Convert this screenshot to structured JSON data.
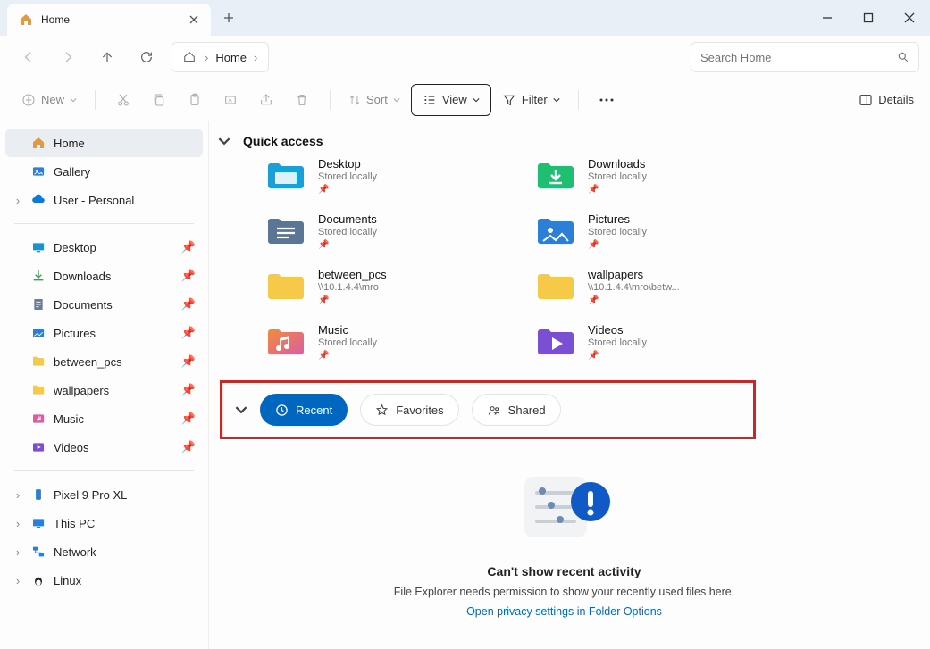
{
  "window": {
    "tab_title": "Home",
    "new_tab": "New tab",
    "minimize": "Minimize",
    "maximize": "Restore",
    "close": "Close"
  },
  "nav": {
    "breadcrumb": {
      "root": "Home"
    },
    "search_placeholder": "Search Home"
  },
  "toolbar": {
    "new": "New",
    "sort": "Sort",
    "view": "View",
    "filter": "Filter",
    "details": "Details"
  },
  "sidebar": {
    "home": "Home",
    "gallery": "Gallery",
    "user_personal": "User - Personal",
    "pinned": [
      {
        "label": "Desktop"
      },
      {
        "label": "Downloads"
      },
      {
        "label": "Documents"
      },
      {
        "label": "Pictures"
      },
      {
        "label": "between_pcs"
      },
      {
        "label": "wallpapers"
      },
      {
        "label": "Music"
      },
      {
        "label": "Videos"
      }
    ],
    "devices": [
      {
        "label": "Pixel 9 Pro XL"
      },
      {
        "label": "This PC"
      },
      {
        "label": "Network"
      },
      {
        "label": "Linux"
      }
    ]
  },
  "quick_access": {
    "header": "Quick access",
    "items": [
      {
        "name": "Desktop",
        "sub": "Stored locally"
      },
      {
        "name": "Downloads",
        "sub": "Stored locally"
      },
      {
        "name": "Documents",
        "sub": "Stored locally"
      },
      {
        "name": "Pictures",
        "sub": "Stored locally"
      },
      {
        "name": "between_pcs",
        "sub": "\\\\10.1.4.4\\mro"
      },
      {
        "name": "wallpapers",
        "sub": "\\\\10.1.4.4\\mro\\betw..."
      },
      {
        "name": "Music",
        "sub": "Stored locally"
      },
      {
        "name": "Videos",
        "sub": "Stored locally"
      }
    ]
  },
  "recent_tabs": {
    "recent": "Recent",
    "favorites": "Favorites",
    "shared": "Shared"
  },
  "empty": {
    "title": "Can't show recent activity",
    "body": "File Explorer needs permission to show your recently used files here.",
    "link": "Open privacy settings in Folder Options"
  }
}
